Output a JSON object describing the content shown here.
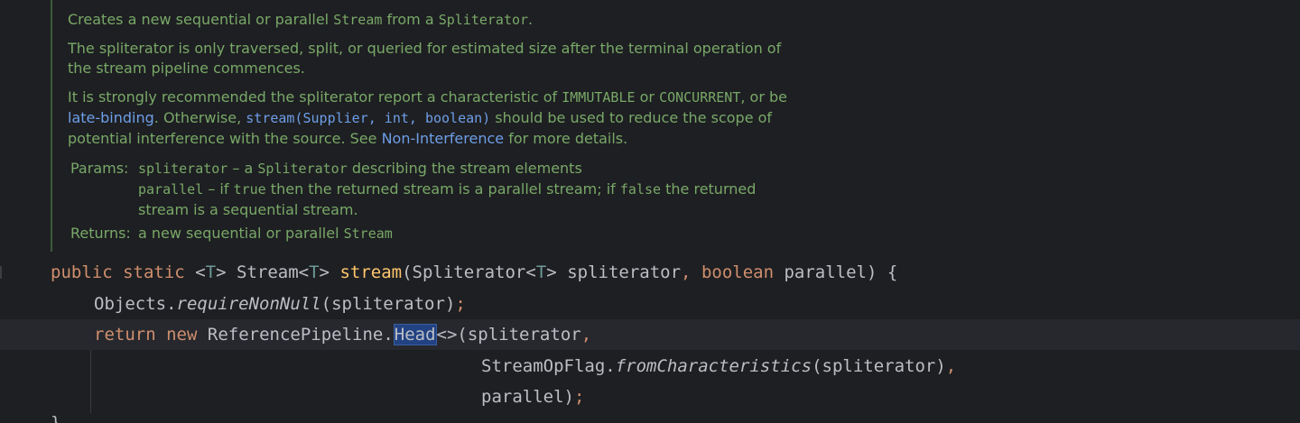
{
  "doc": {
    "p1": {
      "a": "Creates a new sequential or parallel ",
      "b": "Stream",
      "c": " from a ",
      "d": "Spliterator",
      "e": "."
    },
    "p2": {
      "line1": "The spliterator is only traversed, split, or queried for estimated size after the terminal operation of",
      "line2": "the stream pipeline commences."
    },
    "p3": {
      "l1a": "It is strongly recommended the spliterator report a characteristic of ",
      "l1b": "IMMUTABLE",
      "l1c": " or ",
      "l1d": "CONCURRENT",
      "l1e": ", or be",
      "l2a": "late-binding",
      "l2b": ". Otherwise, ",
      "l2c": "stream(Supplier, int, boolean)",
      "l2d": " should be used to reduce the scope of",
      "l3a": "potential interference with the source. See ",
      "l3b": "Non-Interference",
      "l3c": " for more details."
    },
    "params_label": "Params:",
    "params": [
      {
        "name": "spliterator",
        "dash": " – a ",
        "type": "Spliterator",
        "desc": " describing the stream elements"
      },
      {
        "name": "parallel",
        "dash": " – if ",
        "v1": "true",
        "mid": " then the returned stream is a parallel stream; if ",
        "v2": "false",
        "end": " the returned",
        "cont": "stream is a sequential stream."
      }
    ],
    "returns_label": "Returns:",
    "returns": {
      "a": "a new sequential or parallel ",
      "b": "Stream"
    }
  },
  "code": {
    "line1": {
      "kw1": "public",
      "kw2": "static",
      "lt1": "<",
      "T1": "T",
      "gt1": ">",
      "ret": "Stream",
      "lt2": "<",
      "T2": "T",
      "gt2": ">",
      "fn": "stream",
      "p1": "(Spliterator",
      "lt3": "<",
      "T3": "T",
      "gt3": ">",
      "arg1": "spliterator",
      "comma": ",",
      "kw3": "boolean",
      "arg2": "parallel) {"
    },
    "line2": {
      "obj": "Objects.",
      "call": "requireNonNull",
      "args": "(spliterator)",
      "semi": ";"
    },
    "line3": {
      "kw1": "return",
      "kw2": "new",
      "cls": "ReferencePipeline.",
      "sel": "Head",
      "rest": "<>(spliterator",
      "comma": ","
    },
    "line4": {
      "obj": "StreamOpFlag.",
      "call": "fromCharacteristics",
      "args": "(spliterator)",
      "comma": ","
    },
    "line5": {
      "val": "parallel)",
      "semi": ";"
    },
    "line6": {
      "brace": "}"
    }
  },
  "colors": {
    "background": "#1e1f22",
    "doc_text": "#78a868",
    "doc_link": "#6e9ee8",
    "keyword": "#cf8e6d",
    "function": "#ffc66d",
    "selection": "#214283"
  }
}
